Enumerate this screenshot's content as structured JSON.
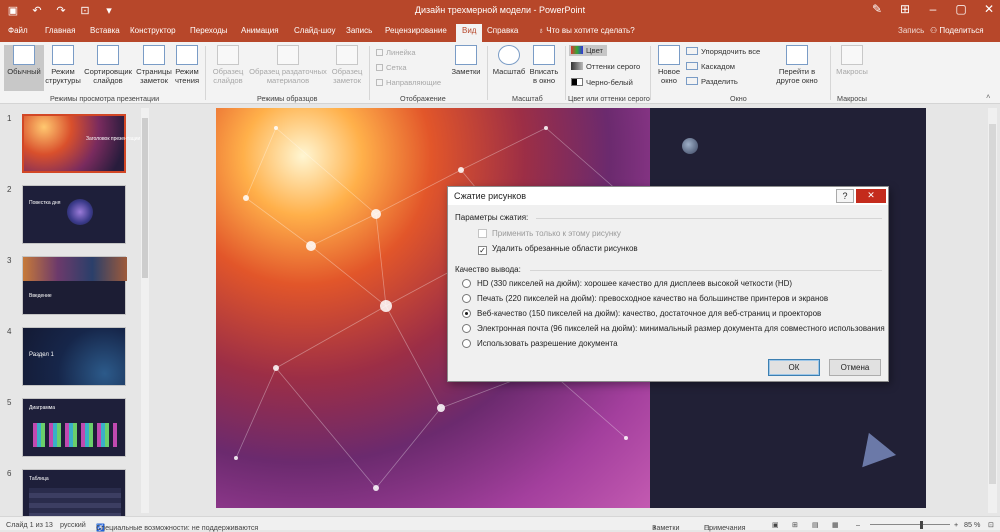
{
  "window": {
    "title": "Дизайн трехмерной модели  -  PowerPoint",
    "qat_icons": [
      "save-icon",
      "undo-icon",
      "redo-icon",
      "start-from-beginning-icon",
      "customize-qat-icon"
    ],
    "window_icons": [
      "pen-icon",
      "ribbon-display-icon",
      "minimize-icon",
      "maximize-icon",
      "close-icon"
    ]
  },
  "menu": {
    "tabs": [
      "Файл",
      "Главная",
      "Вставка",
      "Конструктор",
      "Переходы",
      "Анимация",
      "Слайд-шоу",
      "Запись",
      "Рецензирование",
      "Вид",
      "Справка"
    ],
    "active_tab": "Вид",
    "tell_me": "Что вы хотите сделать?",
    "record": "Запись",
    "share": "Поделиться"
  },
  "ribbon": {
    "groups": {
      "views": "Режимы просмотра презентации",
      "masters": "Режимы образцов",
      "show": "Отображение",
      "zoom": "Масштаб",
      "color": "Цвет или оттенки серого",
      "window": "Окно",
      "macros": "Макросы"
    },
    "views": [
      {
        "line1": "Обычный",
        "line2": ""
      },
      {
        "line1": "Режим",
        "line2": "структуры"
      },
      {
        "line1": "Сортировщик",
        "line2": "слайдов"
      },
      {
        "line1": "Страницы",
        "line2": "заметок"
      },
      {
        "line1": "Режим",
        "line2": "чтения"
      }
    ],
    "masters": [
      {
        "line1": "Образец",
        "line2": "слайдов"
      },
      {
        "line1": "Образец раздаточных",
        "line2": "материалов"
      },
      {
        "line1": "Образец",
        "line2": "заметок"
      }
    ],
    "show": {
      "ruler": "Линейка",
      "grid": "Сетка",
      "guides": "Направляющие",
      "notes": "Заметки"
    },
    "zoom": {
      "zoom": "Масштаб",
      "fit_line1": "Вписать",
      "fit_line2": "в окно"
    },
    "color": {
      "color": "Цвет",
      "grayscale": "Оттенки серого",
      "bw": "Черно-белый"
    },
    "window": {
      "new_line1": "Новое",
      "new_line2": "окно",
      "arrange": "Упорядочить все",
      "cascade": "Каскадом",
      "split": "Разделить",
      "switch_line1": "Перейти в",
      "switch_line2": "другое окно"
    },
    "macros": "Макросы"
  },
  "slides": [
    {
      "num": "1",
      "title": "Заголовок презентации",
      "selected": true
    },
    {
      "num": "2",
      "title": "Повестка дня",
      "selected": false
    },
    {
      "num": "3",
      "title": "Введение",
      "selected": false
    },
    {
      "num": "4",
      "title": "Раздел 1",
      "selected": false
    },
    {
      "num": "5",
      "title": "Диаграмма",
      "selected": false
    },
    {
      "num": "6",
      "title": "Таблица",
      "selected": false
    }
  ],
  "dialog": {
    "title": "Сжатие рисунков",
    "help": "?",
    "close": "✕",
    "section_compress": "Параметры сжатия:",
    "apply_only": "Применить только к этому рисунку",
    "delete_cropped": "Удалить обрезанные области рисунков",
    "section_quality": "Качество вывода:",
    "options": [
      {
        "label": "HD (330 пикселей на дюйм): хорошее качество для дисплеев высокой четкости (HD)",
        "selected": false
      },
      {
        "label": "Печать (220 пикселей на дюйм): превосходное качество на большинстве принтеров и экранов",
        "selected": false
      },
      {
        "label": "Веб-качество (150 пикселей на дюйм): качество, достаточное для веб-страниц и проекторов",
        "selected": true
      },
      {
        "label": "Электронная почта (96 пикселей на дюйм): минимальный размер документа для совместного использования",
        "selected": false
      },
      {
        "label": "Использовать разрешение документа",
        "selected": false
      }
    ],
    "ok": "ОК",
    "cancel": "Отмена"
  },
  "status": {
    "slide": "Слайд 1 из 13",
    "lang": "русский",
    "accessibility": "Специальные возможности: не поддерживаются",
    "notes": "Заметки",
    "comments": "Примечания",
    "zoom": "85 %",
    "zoom_level": 0.64
  },
  "colors": {
    "accent": "#b7472a",
    "close_red": "#c42b1c",
    "dark_panel": "#212036"
  }
}
